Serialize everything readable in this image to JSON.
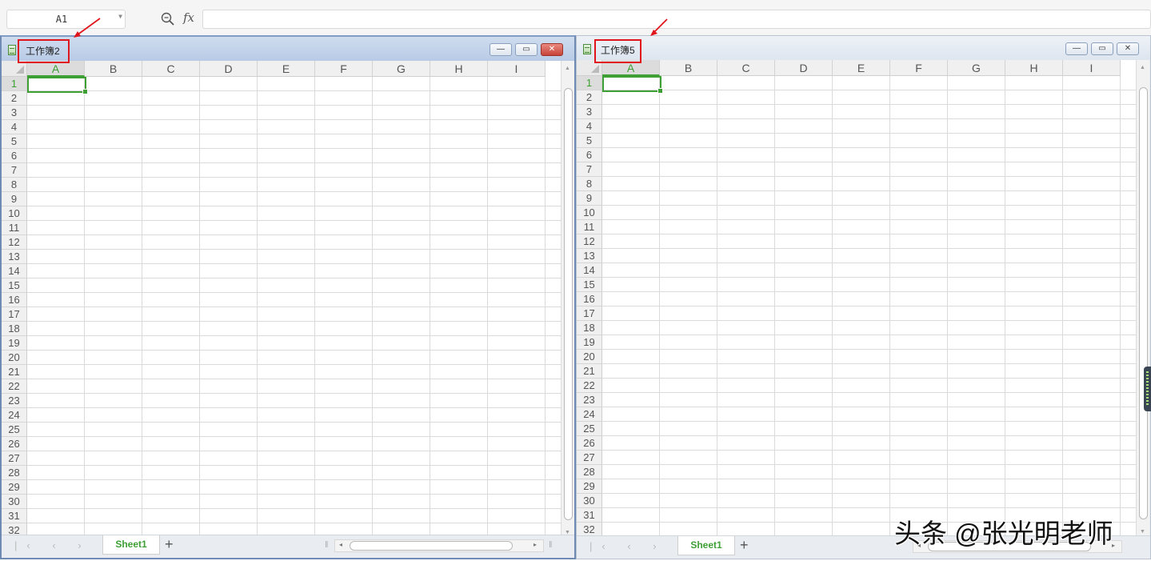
{
  "formula_bar": {
    "name_box": "A1",
    "fx_label": "fx",
    "formula": ""
  },
  "workbooks": [
    {
      "title": "工作簿2",
      "active": true,
      "columns": [
        "A",
        "B",
        "C",
        "D",
        "E",
        "F",
        "G",
        "H",
        "I"
      ],
      "selected_column": "A",
      "selected_row": 1,
      "active_cell": "A1",
      "sheet_tab": "Sheet1"
    },
    {
      "title": "工作簿5",
      "active": false,
      "columns": [
        "A",
        "B",
        "C",
        "D",
        "E",
        "F",
        "G",
        "H",
        "I"
      ],
      "selected_column": "A",
      "selected_row": 1,
      "active_cell": "A1",
      "sheet_tab": "Sheet1"
    }
  ],
  "row_numbers": [
    "1",
    "2",
    "3",
    "4",
    "5",
    "6",
    "7",
    "8",
    "9",
    "10",
    "11",
    "12",
    "13",
    "14",
    "15",
    "16",
    "17",
    "18",
    "19",
    "20",
    "21",
    "22",
    "23",
    "24",
    "25",
    "26",
    "27",
    "28",
    "29",
    "30",
    "31",
    "32"
  ],
  "add_sheet_label": "+",
  "window_controls": {
    "minimize": "—",
    "restore": "▭",
    "close": "✕"
  },
  "watermark": "头条 @张光明老师",
  "colors": {
    "accent_green": "#3e9f35",
    "annotation_red": "#e0161c"
  }
}
